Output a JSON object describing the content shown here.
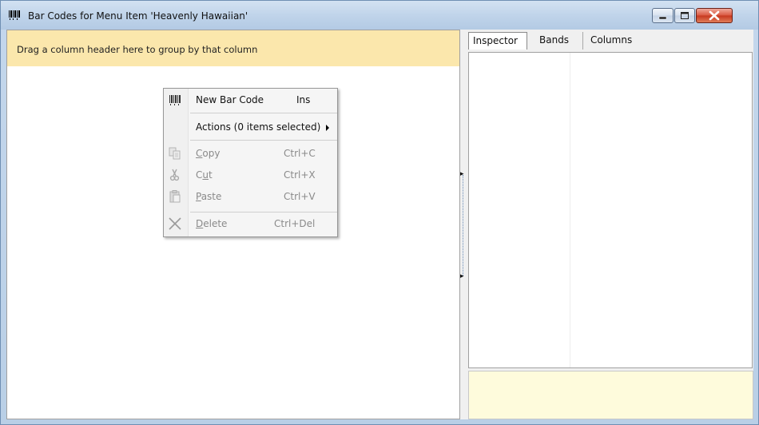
{
  "window": {
    "title": "Bar Codes for Menu Item 'Heavenly Hawaiian'",
    "controls": [
      "minimize",
      "maximize",
      "close"
    ]
  },
  "grid": {
    "group_hint": "Drag a column header here to group by that column"
  },
  "context_menu": {
    "items": [
      {
        "label": "New Bar Code",
        "shortcut": "Ins",
        "icon": "barcode-icon",
        "enabled": true
      },
      {
        "label": "Actions (0 items selected)",
        "shortcut": "",
        "icon": "",
        "enabled": true,
        "submenu": true
      },
      {
        "label_accel": "C",
        "label_rest": "opy",
        "shortcut": "Ctrl+C",
        "icon": "copy-icon",
        "enabled": false
      },
      {
        "label_pre": "C",
        "label_accel": "u",
        "label_rest": "t",
        "shortcut": "Ctrl+X",
        "icon": "scissors-icon",
        "enabled": false
      },
      {
        "label_accel": "P",
        "label_rest": "aste",
        "shortcut": "Ctrl+V",
        "icon": "paste-icon",
        "enabled": false
      },
      {
        "label_accel": "D",
        "label_rest": "elete",
        "shortcut": "Ctrl+Del",
        "icon": "delete-x-icon",
        "enabled": false
      }
    ]
  },
  "right_panel": {
    "tabs": [
      "Inspector",
      "Bands",
      "Columns"
    ],
    "active_tab": "Inspector"
  },
  "colors": {
    "group_bar": "#fbe7ac",
    "description_panel": "#fefbdc",
    "title_bar": "#c0d4ea",
    "close_button": "#c7371f"
  }
}
